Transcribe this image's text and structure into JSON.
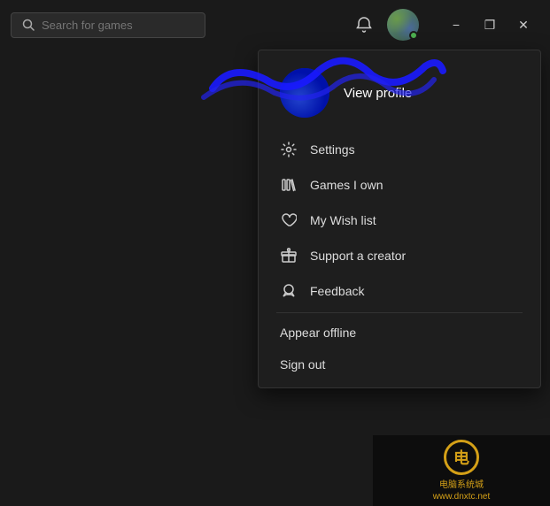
{
  "titlebar": {
    "search_placeholder": "Search for games",
    "minimize_label": "−",
    "restore_label": "❐",
    "close_label": "✕"
  },
  "profile": {
    "view_profile_label": "View profile"
  },
  "menu": {
    "settings_label": "Settings",
    "games_own_label": "Games I own",
    "wishlist_label": "My Wish list",
    "support_label": "Support a creator",
    "feedback_label": "Feedback",
    "appear_offline_label": "Appear offline",
    "sign_out_label": "Sign out"
  },
  "watermark": {
    "site_symbol": "电",
    "site_line1": "电脑系统城",
    "site_line2": "www.dnxtc.net"
  }
}
